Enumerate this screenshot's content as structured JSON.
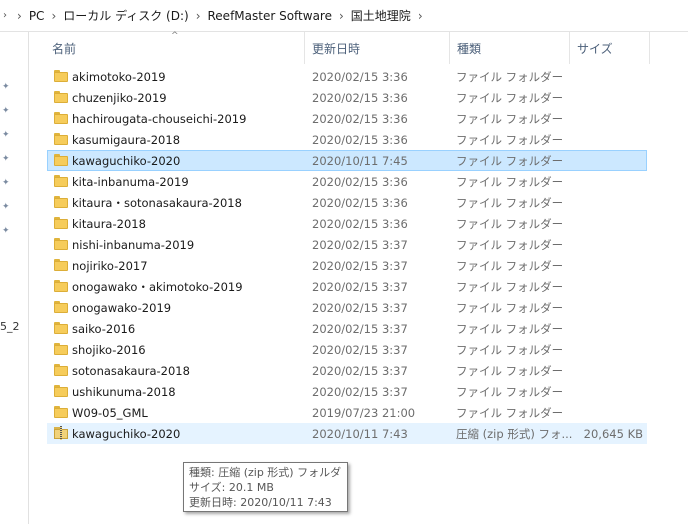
{
  "breadcrumb": {
    "lead_icon": "up-arrow-icon",
    "items": [
      "PC",
      "ローカル ディスク (D:)",
      "ReefMaster Software",
      "国土地理院"
    ]
  },
  "columns": {
    "name": "名前",
    "date": "更新日時",
    "type": "種類",
    "size": "サイズ"
  },
  "sort_indicator": "^",
  "nav_cut_text": "5_2",
  "rows": [
    {
      "name": "akimotoko-2019",
      "date": "2020/02/15 3:36",
      "type": "ファイル フォルダー",
      "size": "",
      "icon": "folder-icon"
    },
    {
      "name": "chuzenjiko-2019",
      "date": "2020/02/15 3:36",
      "type": "ファイル フォルダー",
      "size": "",
      "icon": "folder-icon"
    },
    {
      "name": "hachirougata-chouseichi-2019",
      "date": "2020/02/15 3:36",
      "type": "ファイル フォルダー",
      "size": "",
      "icon": "folder-icon"
    },
    {
      "name": "kasumigaura-2018",
      "date": "2020/02/15 3:36",
      "type": "ファイル フォルダー",
      "size": "",
      "icon": "folder-icon"
    },
    {
      "name": "kawaguchiko-2020",
      "date": "2020/10/11 7:45",
      "type": "ファイル フォルダー",
      "size": "",
      "icon": "folder-icon",
      "state": "selected"
    },
    {
      "name": "kita-inbanuma-2019",
      "date": "2020/02/15 3:36",
      "type": "ファイル フォルダー",
      "size": "",
      "icon": "folder-icon"
    },
    {
      "name": "kitaura・sotonasakaura-2018",
      "date": "2020/02/15 3:36",
      "type": "ファイル フォルダー",
      "size": "",
      "icon": "folder-icon"
    },
    {
      "name": "kitaura-2018",
      "date": "2020/02/15 3:36",
      "type": "ファイル フォルダー",
      "size": "",
      "icon": "folder-icon"
    },
    {
      "name": "nishi-inbanuma-2019",
      "date": "2020/02/15 3:37",
      "type": "ファイル フォルダー",
      "size": "",
      "icon": "folder-icon"
    },
    {
      "name": "nojiriko-2017",
      "date": "2020/02/15 3:37",
      "type": "ファイル フォルダー",
      "size": "",
      "icon": "folder-icon"
    },
    {
      "name": "onogawako・akimotoko-2019",
      "date": "2020/02/15 3:37",
      "type": "ファイル フォルダー",
      "size": "",
      "icon": "folder-icon"
    },
    {
      "name": "onogawako-2019",
      "date": "2020/02/15 3:37",
      "type": "ファイル フォルダー",
      "size": "",
      "icon": "folder-icon"
    },
    {
      "name": "saiko-2016",
      "date": "2020/02/15 3:37",
      "type": "ファイル フォルダー",
      "size": "",
      "icon": "folder-icon"
    },
    {
      "name": "shojiko-2016",
      "date": "2020/02/15 3:37",
      "type": "ファイル フォルダー",
      "size": "",
      "icon": "folder-icon"
    },
    {
      "name": "sotonasakaura-2018",
      "date": "2020/02/15 3:37",
      "type": "ファイル フォルダー",
      "size": "",
      "icon": "folder-icon"
    },
    {
      "name": "ushikunuma-2018",
      "date": "2020/02/15 3:37",
      "type": "ファイル フォルダー",
      "size": "",
      "icon": "folder-icon"
    },
    {
      "name": "W09-05_GML",
      "date": "2019/07/23 21:00",
      "type": "ファイル フォルダー",
      "size": "",
      "icon": "folder-icon"
    },
    {
      "name": "kawaguchiko-2020",
      "date": "2020/10/11 7:43",
      "type": "圧縮 (zip 形式) フォ...",
      "size": "20,645 KB",
      "icon": "zip-folder-icon",
      "state": "hover"
    }
  ],
  "tooltip": {
    "line1": "種類: 圧縮 (zip 形式) フォルダー",
    "line2": "サイズ: 20.1 MB",
    "line3": "更新日時: 2020/10/11 7:43"
  },
  "colors": {
    "selected_bg": "#cce8ff",
    "selected_border": "#99d1ff",
    "hover_bg": "#e5f3ff",
    "header_text": "#4c607a",
    "folder": "#f6cc5b"
  }
}
